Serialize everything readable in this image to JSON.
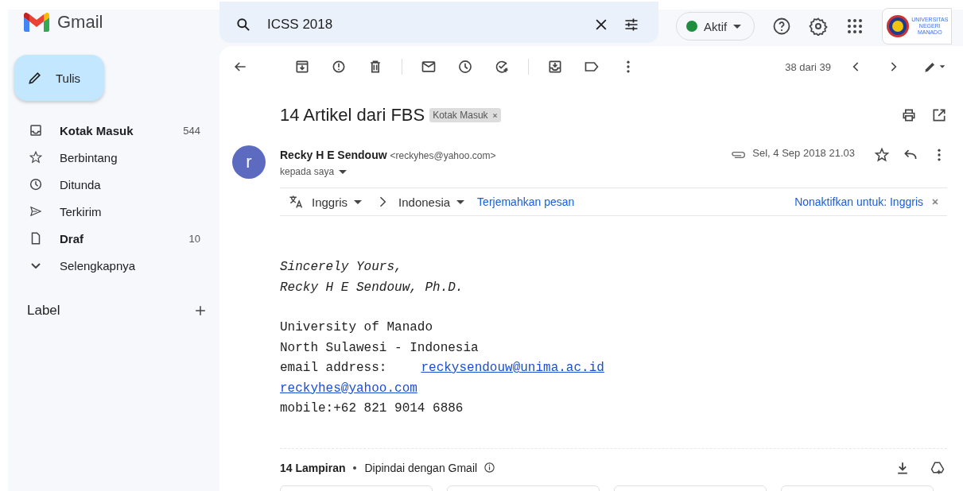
{
  "header": {
    "app_name": "Gmail",
    "search": {
      "value": "ICSS 2018"
    },
    "status": {
      "label": "Aktif",
      "color": "#1e8e3e"
    },
    "account_logo": [
      "UNIVERSITAS",
      "NEGERI",
      "MANADO"
    ]
  },
  "compose": {
    "label": "Tulis"
  },
  "sidebar": {
    "items": [
      {
        "kind": "inbox",
        "label": "Kotak Masuk",
        "count": "544",
        "unread": true
      },
      {
        "kind": "star",
        "label": "Berbintang",
        "unread": false
      },
      {
        "kind": "clock",
        "label": "Ditunda",
        "unread": false
      },
      {
        "kind": "send",
        "label": "Terkirim",
        "unread": false
      },
      {
        "kind": "file",
        "label": "Draf",
        "count": "10",
        "unread": true
      },
      {
        "kind": "chevron",
        "label": "Selengkapnya",
        "unread": false
      }
    ],
    "label_heading": "Label"
  },
  "toolbar": {
    "pager": "38 dari 39"
  },
  "message": {
    "subject": "14 Artikel dari FBS",
    "label_chip": "Kotak Masuk",
    "avatar_letter": "r",
    "sender_name": "Recky H E Sendouw",
    "sender_email": "<reckyhes@yahoo.com>",
    "recipient": "kepada saya",
    "date": "Sel, 4 Sep 2018 21.03",
    "has_attachment": true,
    "starred": false,
    "translate": {
      "from": "Inggris",
      "to": "Indonesia",
      "action": "Terjemahkan pesan",
      "disable": "Nonaktifkan untuk: Inggris"
    },
    "body": [
      {
        "kind": "italic",
        "text": "Sincerely Yours,"
      },
      {
        "kind": "italic",
        "text": "Recky H E Sendouw, Ph.D."
      },
      {
        "kind": "plain",
        "text": "University of Manado",
        "gap_before": true
      },
      {
        "kind": "plain",
        "text": "North Sulawesi - Indonesia"
      },
      {
        "kind": "label_link",
        "text": "email address:",
        "link": "reckysendouw@unima.ac.id"
      },
      {
        "kind": "link",
        "link": "reckyhes@yahoo.com"
      },
      {
        "kind": "plain",
        "text": "mobile:+62 821 9014 6886"
      }
    ],
    "attachments": {
      "title": "14 Lampiran",
      "note": "Dipindai dengan Gmail"
    }
  }
}
